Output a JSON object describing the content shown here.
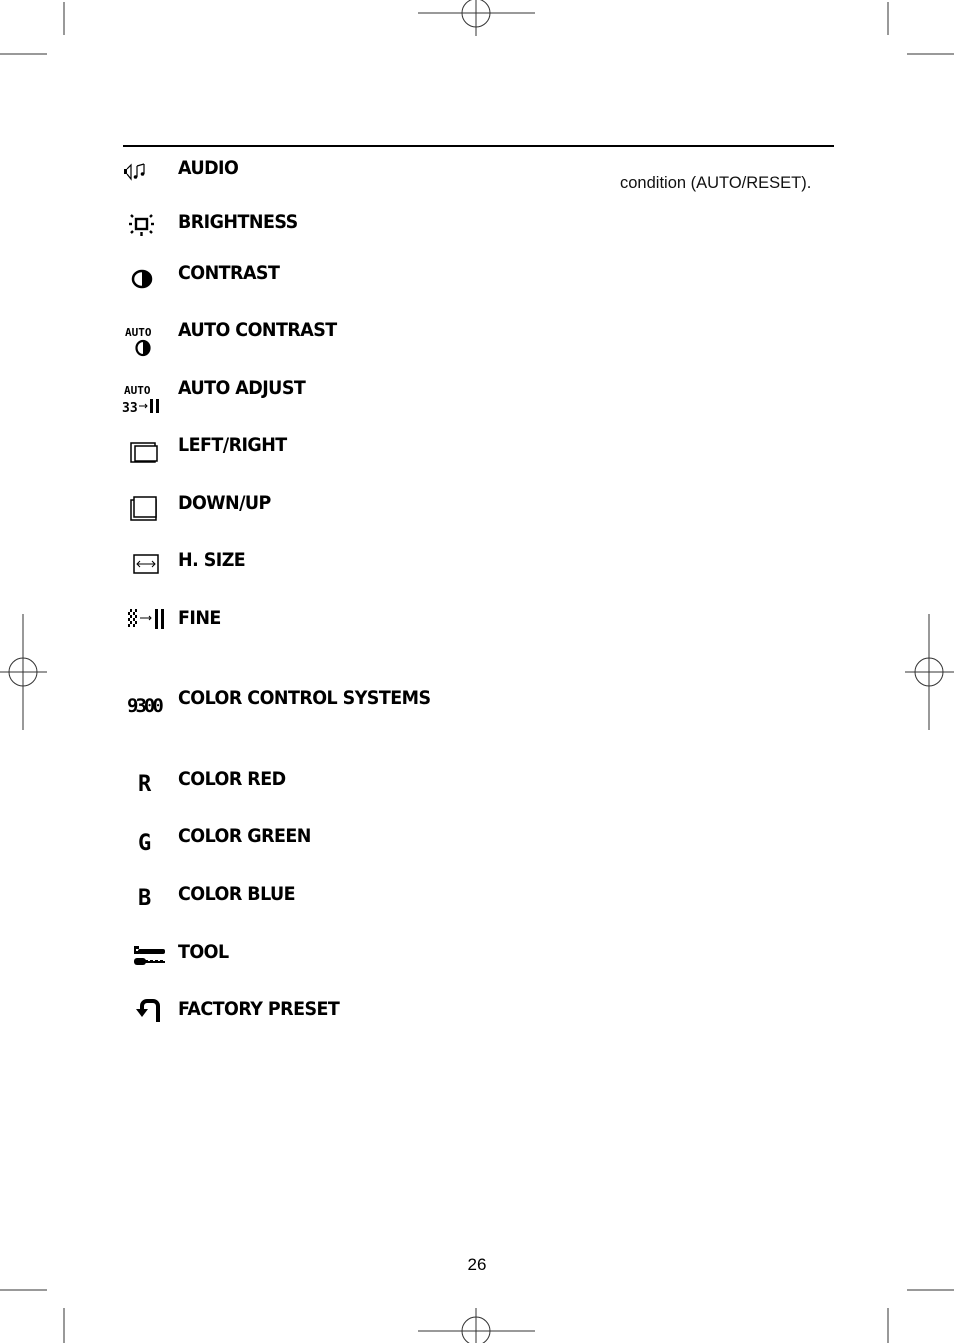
{
  "document": {
    "continued_text": "condition (AUTO/RESET).",
    "page_number": "26"
  },
  "menu": {
    "items": [
      {
        "label": "AUDIO",
        "icon": "audio-icon"
      },
      {
        "label": "BRIGHTNESS",
        "icon": "brightness-icon"
      },
      {
        "label": "CONTRAST",
        "icon": "contrast-icon"
      },
      {
        "label": "AUTO CONTRAST",
        "icon": "auto-contrast-icon"
      },
      {
        "label": "AUTO ADJUST",
        "icon": "auto-adjust-icon"
      },
      {
        "label": "LEFT/RIGHT",
        "icon": "left-right-position-icon"
      },
      {
        "label": "DOWN/UP",
        "icon": "down-up-position-icon"
      },
      {
        "label": "H. SIZE",
        "icon": "h-size-icon"
      },
      {
        "label": "FINE",
        "icon": "fine-icon"
      },
      {
        "label": "COLOR CONTROL SYSTEMS",
        "icon": "color-temperature-9300-icon",
        "icon_text": "9300"
      },
      {
        "label": "COLOR RED",
        "icon": "color-red-icon",
        "icon_text": "R"
      },
      {
        "label": "COLOR GREEN",
        "icon": "color-green-icon",
        "icon_text": "G"
      },
      {
        "label": "COLOR BLUE",
        "icon": "color-blue-icon",
        "icon_text": "B"
      },
      {
        "label": "TOOL",
        "icon": "tool-icon"
      },
      {
        "label": "FACTORY PRESET",
        "icon": "factory-preset-icon"
      }
    ],
    "auto_icon_text": "AUTO"
  }
}
